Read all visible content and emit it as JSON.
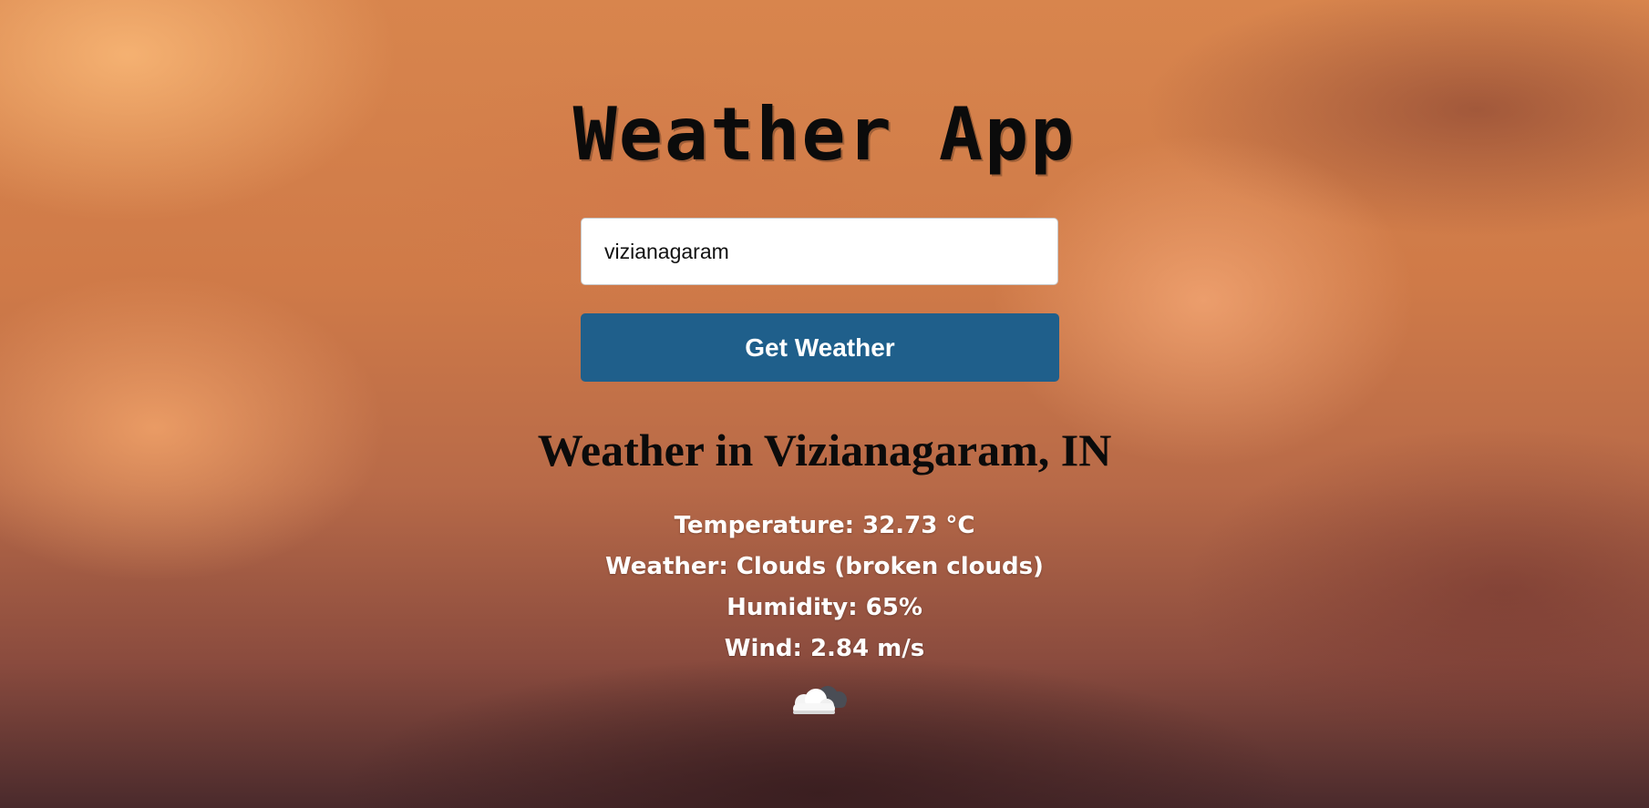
{
  "app": {
    "title": "Weather App"
  },
  "search": {
    "value": "vizianagaram"
  },
  "button": {
    "label": "Get Weather"
  },
  "result": {
    "heading": "Weather in Vizianagaram, IN",
    "temperature": "Temperature: 32.73 °C",
    "weather": "Weather: Clouds (broken clouds)",
    "humidity": "Humidity: 65%",
    "wind": "Wind: 2.84 m/s",
    "icon": "broken-clouds-icon"
  },
  "colors": {
    "button_bg": "#1f5f8b",
    "title_text": "#0b0b0b",
    "detail_text": "#ffffff"
  }
}
